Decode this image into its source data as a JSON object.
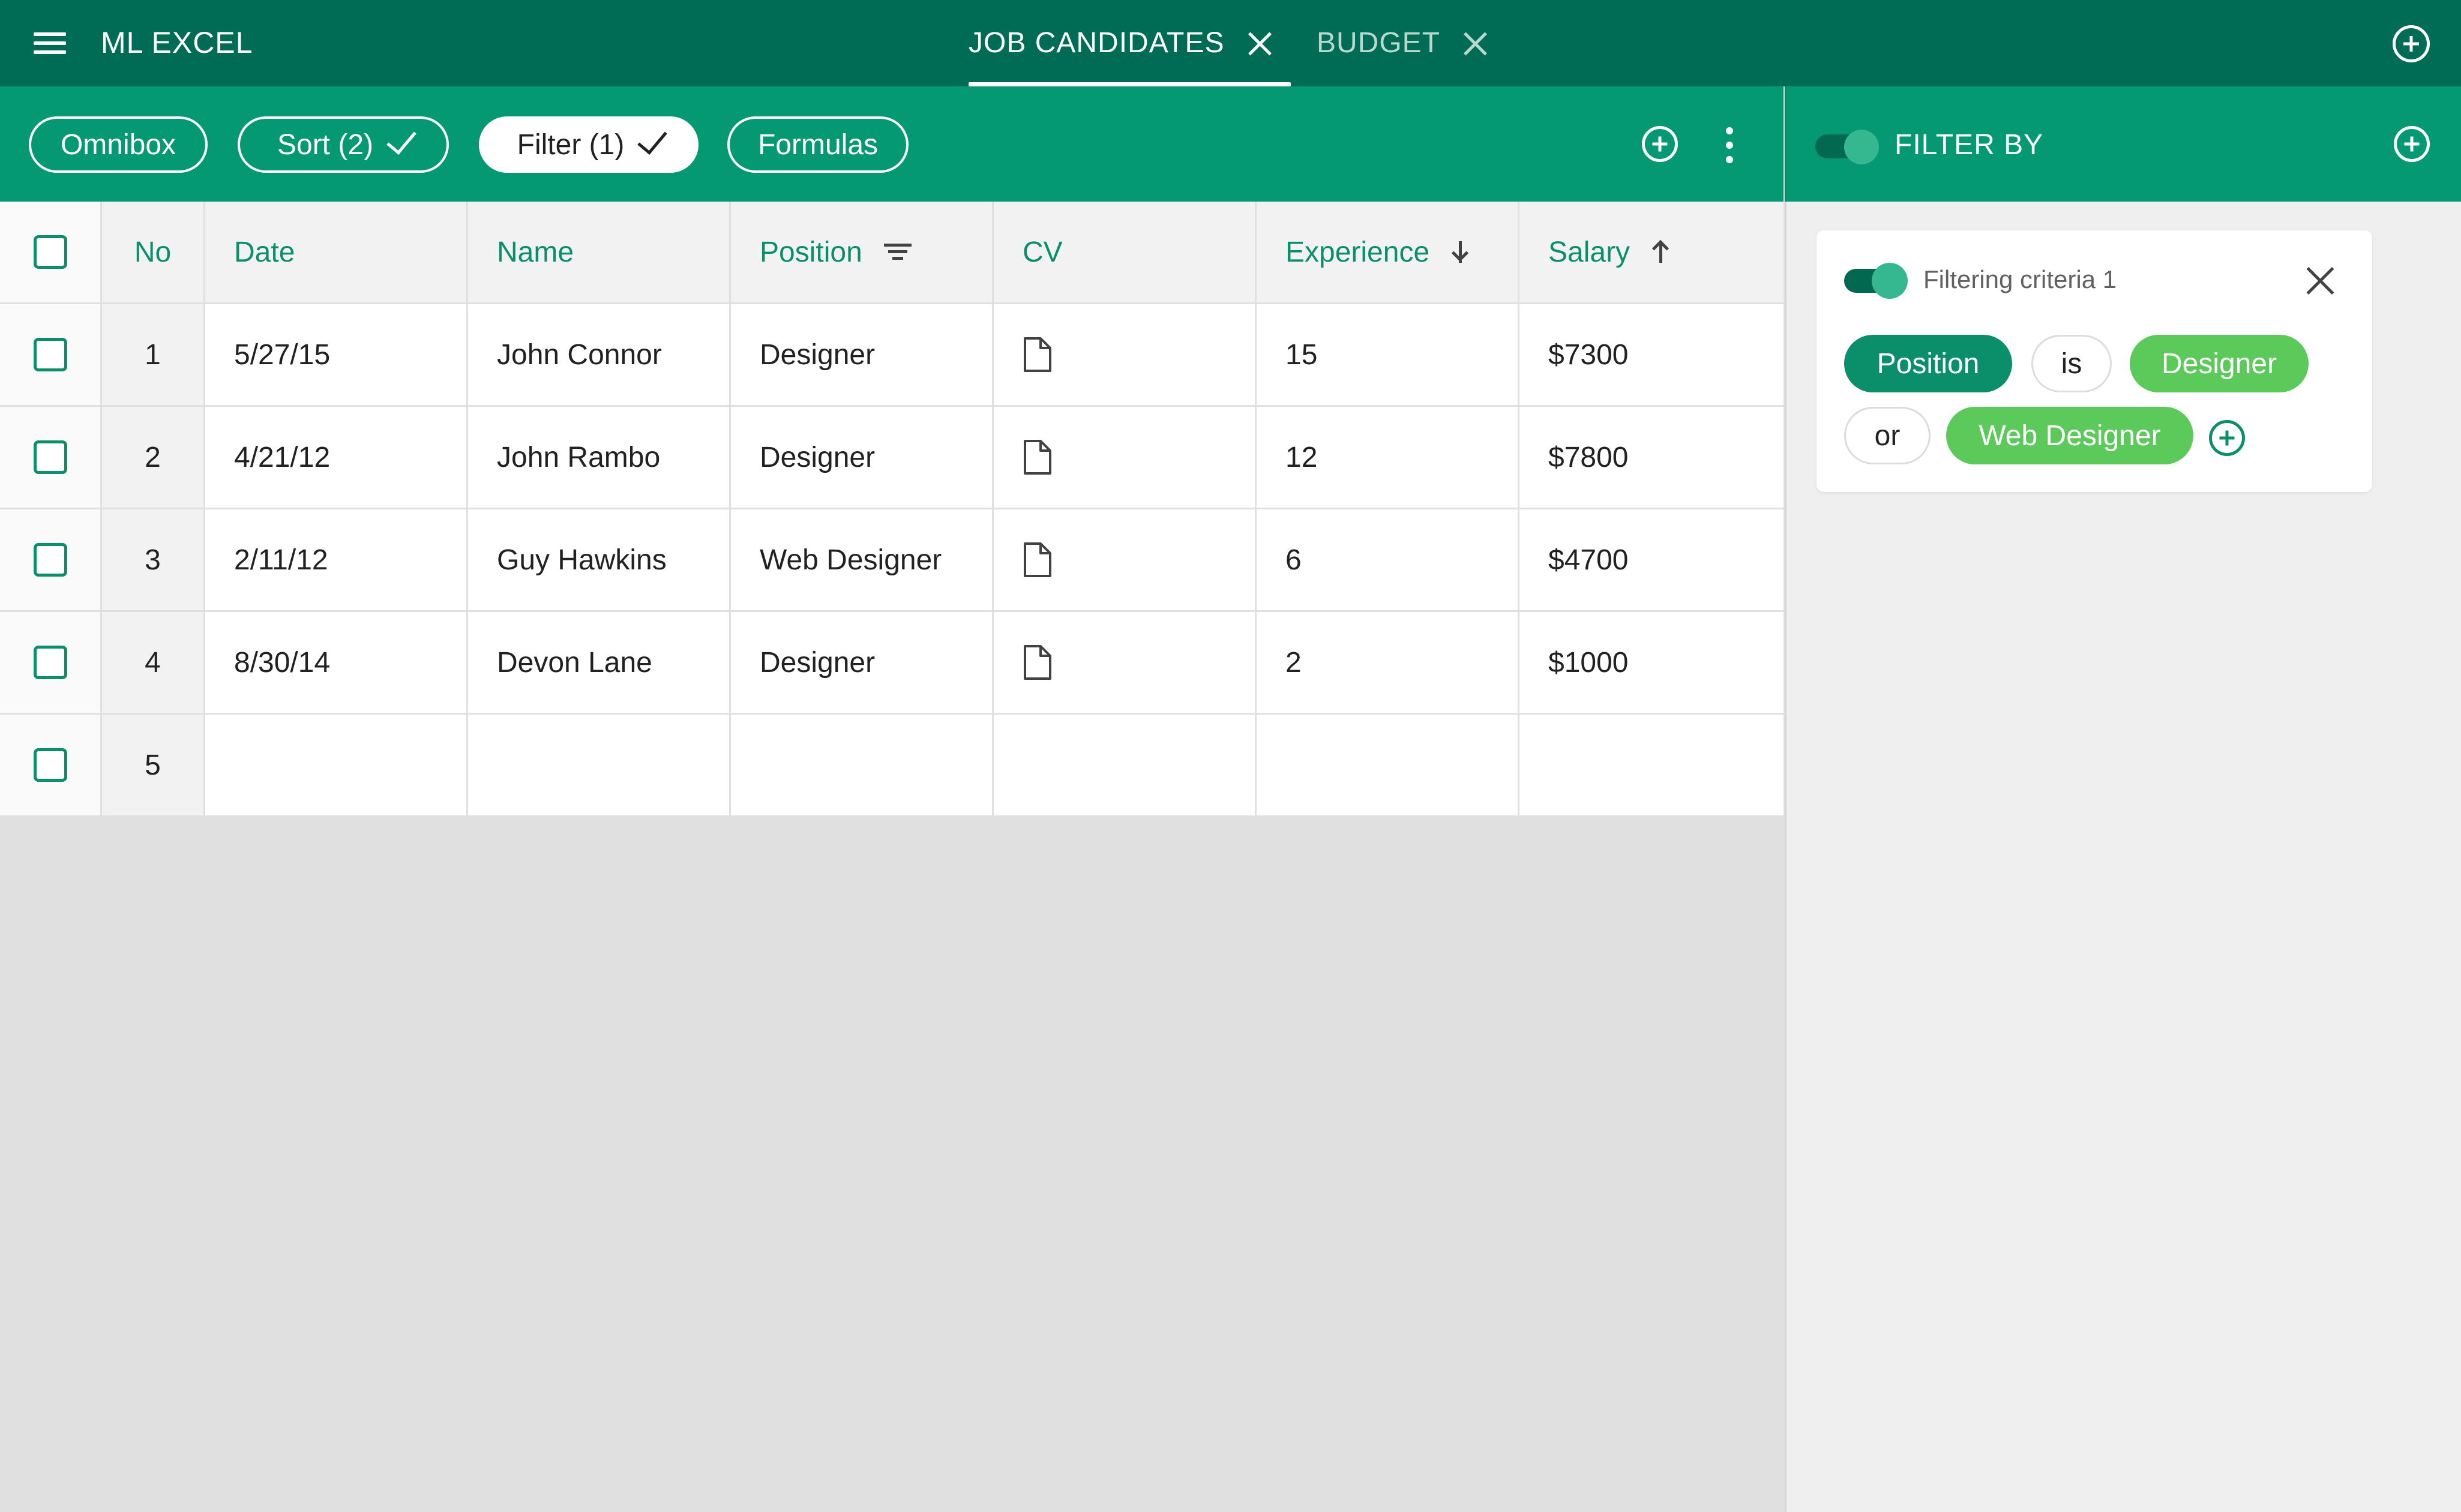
{
  "app": {
    "title": "ML EXCEL",
    "menu_icon": "hamburger-menu-icon",
    "add_icon": "add-circle-icon"
  },
  "tabs": [
    {
      "label": "JOB CANDIDATES",
      "active": true
    },
    {
      "label": "BUDGET",
      "active": false
    }
  ],
  "toolbar": {
    "chips": [
      {
        "label": "Omnibox",
        "checked": false
      },
      {
        "label": "Sort (2)",
        "checked": true
      },
      {
        "label": "Filter (1)",
        "checked": true,
        "selected": true
      },
      {
        "label": "Formulas",
        "checked": false
      }
    ]
  },
  "table": {
    "columns": [
      {
        "label": "No"
      },
      {
        "label": "Date"
      },
      {
        "label": "Name"
      },
      {
        "label": "Position",
        "icon": "filter-icon"
      },
      {
        "label": "CV"
      },
      {
        "label": "Experience",
        "icon": "arrow-down-icon"
      },
      {
        "label": "Salary",
        "icon": "arrow-up-icon"
      }
    ],
    "rows": [
      {
        "no": "1",
        "date": "5/27/15",
        "name": "John Connor",
        "position": "Designer",
        "cv": "document-icon",
        "experience": "15",
        "salary": "$7300"
      },
      {
        "no": "2",
        "date": "4/21/12",
        "name": "John Rambo",
        "position": "Designer",
        "cv": "document-icon",
        "experience": "12",
        "salary": "$7800"
      },
      {
        "no": "3",
        "date": "2/11/12",
        "name": "Guy Hawkins",
        "position": "Web Designer",
        "cv": "document-icon",
        "experience": "6",
        "salary": "$4700"
      },
      {
        "no": "4",
        "date": "8/30/14",
        "name": "Devon Lane",
        "position": "Designer",
        "cv": "document-icon",
        "experience": "2",
        "salary": "$1000"
      },
      {
        "no": "5",
        "date": "",
        "name": "",
        "position": "",
        "cv": "",
        "experience": "",
        "salary": ""
      }
    ]
  },
  "filter_panel": {
    "title": "FILTER BY",
    "enabled": true,
    "criteria": [
      {
        "title": "Filtering criteria 1",
        "enabled": true,
        "field": "Position",
        "operator": "is",
        "values": [
          "Designer",
          "Web Designer"
        ],
        "joiner": "or"
      }
    ]
  },
  "colors": {
    "appbar": "#016c56",
    "toolbar": "#049873",
    "accent": "#0a8f6a",
    "value_pill": "#5cc95b",
    "workspace": "#e0e0e0"
  }
}
